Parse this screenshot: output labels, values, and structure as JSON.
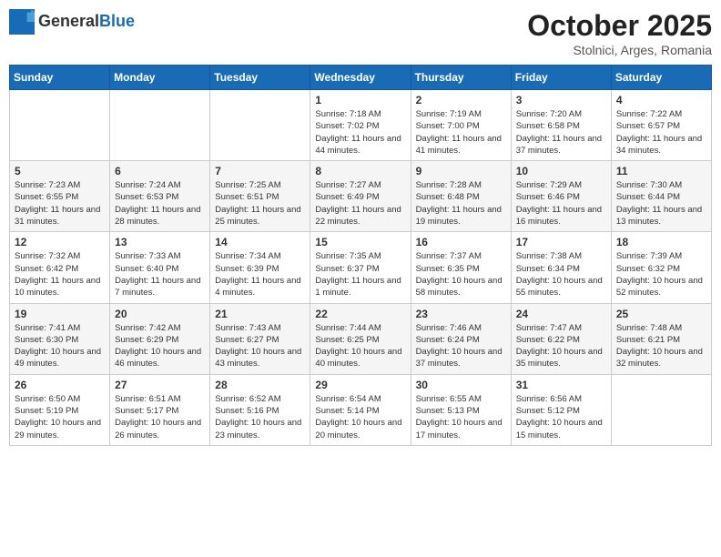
{
  "logo": {
    "text1": "General",
    "text2": "Blue"
  },
  "title": "October 2025",
  "location": "Stolnici, Arges, Romania",
  "weekdays": [
    "Sunday",
    "Monday",
    "Tuesday",
    "Wednesday",
    "Thursday",
    "Friday",
    "Saturday"
  ],
  "weeks": [
    [
      {
        "day": "",
        "info": ""
      },
      {
        "day": "",
        "info": ""
      },
      {
        "day": "",
        "info": ""
      },
      {
        "day": "1",
        "info": "Sunrise: 7:18 AM\nSunset: 7:02 PM\nDaylight: 11 hours and 44 minutes."
      },
      {
        "day": "2",
        "info": "Sunrise: 7:19 AM\nSunset: 7:00 PM\nDaylight: 11 hours and 41 minutes."
      },
      {
        "day": "3",
        "info": "Sunrise: 7:20 AM\nSunset: 6:58 PM\nDaylight: 11 hours and 37 minutes."
      },
      {
        "day": "4",
        "info": "Sunrise: 7:22 AM\nSunset: 6:57 PM\nDaylight: 11 hours and 34 minutes."
      }
    ],
    [
      {
        "day": "5",
        "info": "Sunrise: 7:23 AM\nSunset: 6:55 PM\nDaylight: 11 hours and 31 minutes."
      },
      {
        "day": "6",
        "info": "Sunrise: 7:24 AM\nSunset: 6:53 PM\nDaylight: 11 hours and 28 minutes."
      },
      {
        "day": "7",
        "info": "Sunrise: 7:25 AM\nSunset: 6:51 PM\nDaylight: 11 hours and 25 minutes."
      },
      {
        "day": "8",
        "info": "Sunrise: 7:27 AM\nSunset: 6:49 PM\nDaylight: 11 hours and 22 minutes."
      },
      {
        "day": "9",
        "info": "Sunrise: 7:28 AM\nSunset: 6:48 PM\nDaylight: 11 hours and 19 minutes."
      },
      {
        "day": "10",
        "info": "Sunrise: 7:29 AM\nSunset: 6:46 PM\nDaylight: 11 hours and 16 minutes."
      },
      {
        "day": "11",
        "info": "Sunrise: 7:30 AM\nSunset: 6:44 PM\nDaylight: 11 hours and 13 minutes."
      }
    ],
    [
      {
        "day": "12",
        "info": "Sunrise: 7:32 AM\nSunset: 6:42 PM\nDaylight: 11 hours and 10 minutes."
      },
      {
        "day": "13",
        "info": "Sunrise: 7:33 AM\nSunset: 6:40 PM\nDaylight: 11 hours and 7 minutes."
      },
      {
        "day": "14",
        "info": "Sunrise: 7:34 AM\nSunset: 6:39 PM\nDaylight: 11 hours and 4 minutes."
      },
      {
        "day": "15",
        "info": "Sunrise: 7:35 AM\nSunset: 6:37 PM\nDaylight: 11 hours and 1 minute."
      },
      {
        "day": "16",
        "info": "Sunrise: 7:37 AM\nSunset: 6:35 PM\nDaylight: 10 hours and 58 minutes."
      },
      {
        "day": "17",
        "info": "Sunrise: 7:38 AM\nSunset: 6:34 PM\nDaylight: 10 hours and 55 minutes."
      },
      {
        "day": "18",
        "info": "Sunrise: 7:39 AM\nSunset: 6:32 PM\nDaylight: 10 hours and 52 minutes."
      }
    ],
    [
      {
        "day": "19",
        "info": "Sunrise: 7:41 AM\nSunset: 6:30 PM\nDaylight: 10 hours and 49 minutes."
      },
      {
        "day": "20",
        "info": "Sunrise: 7:42 AM\nSunset: 6:29 PM\nDaylight: 10 hours and 46 minutes."
      },
      {
        "day": "21",
        "info": "Sunrise: 7:43 AM\nSunset: 6:27 PM\nDaylight: 10 hours and 43 minutes."
      },
      {
        "day": "22",
        "info": "Sunrise: 7:44 AM\nSunset: 6:25 PM\nDaylight: 10 hours and 40 minutes."
      },
      {
        "day": "23",
        "info": "Sunrise: 7:46 AM\nSunset: 6:24 PM\nDaylight: 10 hours and 37 minutes."
      },
      {
        "day": "24",
        "info": "Sunrise: 7:47 AM\nSunset: 6:22 PM\nDaylight: 10 hours and 35 minutes."
      },
      {
        "day": "25",
        "info": "Sunrise: 7:48 AM\nSunset: 6:21 PM\nDaylight: 10 hours and 32 minutes."
      }
    ],
    [
      {
        "day": "26",
        "info": "Sunrise: 6:50 AM\nSunset: 5:19 PM\nDaylight: 10 hours and 29 minutes."
      },
      {
        "day": "27",
        "info": "Sunrise: 6:51 AM\nSunset: 5:17 PM\nDaylight: 10 hours and 26 minutes."
      },
      {
        "day": "28",
        "info": "Sunrise: 6:52 AM\nSunset: 5:16 PM\nDaylight: 10 hours and 23 minutes."
      },
      {
        "day": "29",
        "info": "Sunrise: 6:54 AM\nSunset: 5:14 PM\nDaylight: 10 hours and 20 minutes."
      },
      {
        "day": "30",
        "info": "Sunrise: 6:55 AM\nSunset: 5:13 PM\nDaylight: 10 hours and 17 minutes."
      },
      {
        "day": "31",
        "info": "Sunrise: 6:56 AM\nSunset: 5:12 PM\nDaylight: 10 hours and 15 minutes."
      },
      {
        "day": "",
        "info": ""
      }
    ]
  ]
}
